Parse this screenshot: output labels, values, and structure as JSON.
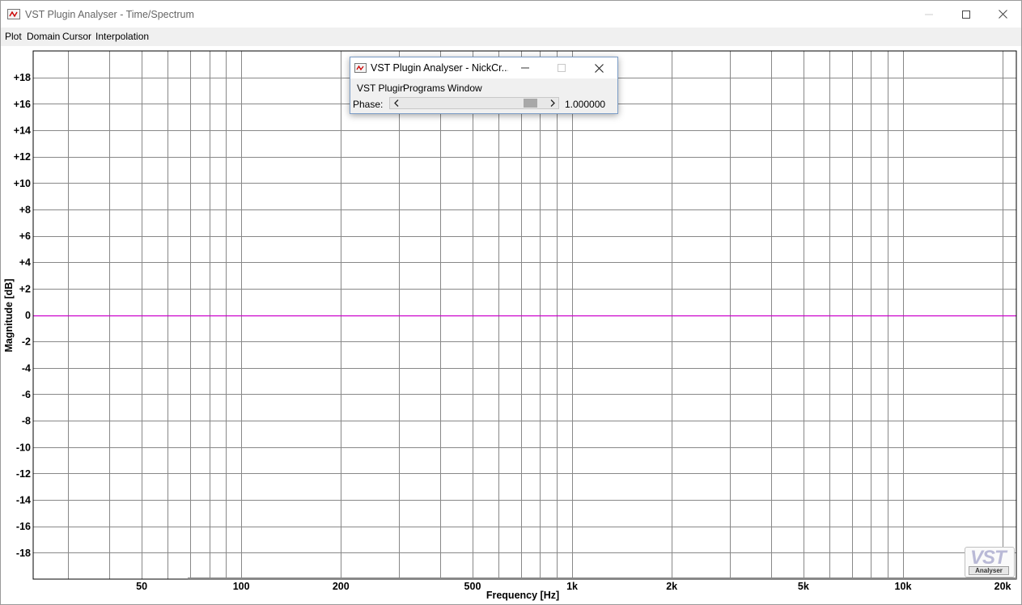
{
  "window": {
    "title": "VST Plugin Analyser - Time/Spectrum",
    "icons": [
      "app-icon",
      "minimize-icon",
      "maximize-icon",
      "close-icon"
    ]
  },
  "menu": [
    "Plot",
    "Domain",
    "Cursor",
    "Interpolation"
  ],
  "plugin_window": {
    "title": "VST Plugin Analyser - NickCr...",
    "menu": [
      "VST Plugin",
      "Programs",
      "Window"
    ],
    "phase_label": "Phase:",
    "phase_value": "1.000000",
    "phase_slider_level": 0.93
  },
  "logo": {
    "text": "VST",
    "subtext": "Analyser"
  },
  "colors": {
    "trace": "#cc00cc",
    "grid": "#888888",
    "menu_bg": "#f0f0f0"
  },
  "chart_data": {
    "type": "line",
    "xlabel": "Frequency [Hz]",
    "ylabel": "Magnitude [dB]",
    "x_scale": "log",
    "xlim": [
      23.5,
      22000
    ],
    "ylim": [
      -20,
      20
    ],
    "x_ticks": [
      50,
      100,
      200,
      500,
      1000,
      2000,
      5000,
      10000,
      20000
    ],
    "x_tick_labels": [
      "50",
      "100",
      "200",
      "500",
      "1k",
      "2k",
      "5k",
      "10k",
      "20k"
    ],
    "y_ticks": [
      18,
      16,
      14,
      12,
      10,
      8,
      6,
      4,
      2,
      0,
      -2,
      -4,
      -6,
      -8,
      -10,
      -12,
      -14,
      -16,
      -18
    ],
    "y_tick_labels": [
      "+18",
      "+16",
      "+14",
      "+12",
      "+10",
      "+8",
      "+6",
      "+4",
      "+2",
      "0",
      "-2",
      "-4",
      "-6",
      "-8",
      "-10",
      "-12",
      "-14",
      "-16",
      "-18"
    ],
    "grid": true,
    "series": [
      {
        "x": [
          23.5,
          22000
        ],
        "y": [
          0,
          0
        ]
      }
    ]
  }
}
